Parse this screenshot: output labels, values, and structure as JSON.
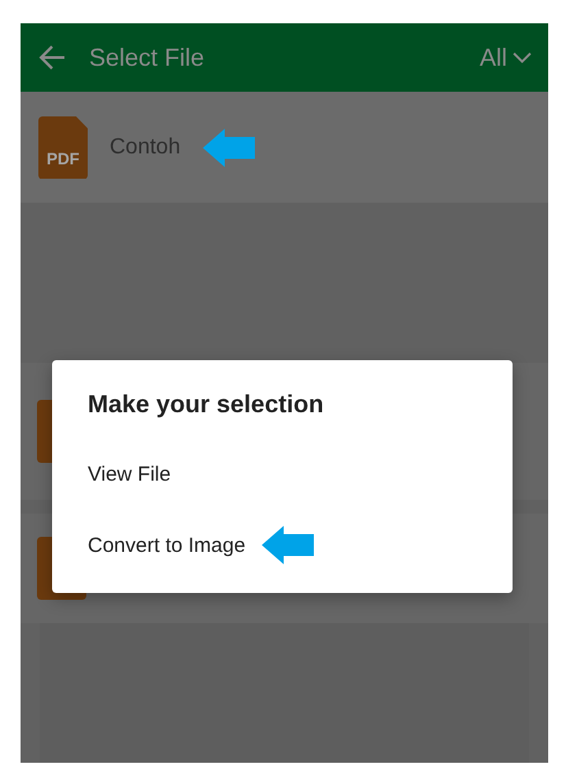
{
  "app_bar": {
    "title": "Select File",
    "filter": "All"
  },
  "files": [
    {
      "icon_label": "PDF",
      "name": "Contoh",
      "pointer": true
    }
  ],
  "dialog": {
    "title": "Make your selection",
    "options": [
      {
        "label": "View File",
        "pointer": false
      },
      {
        "label": "Convert to Image",
        "pointer": true
      }
    ]
  }
}
